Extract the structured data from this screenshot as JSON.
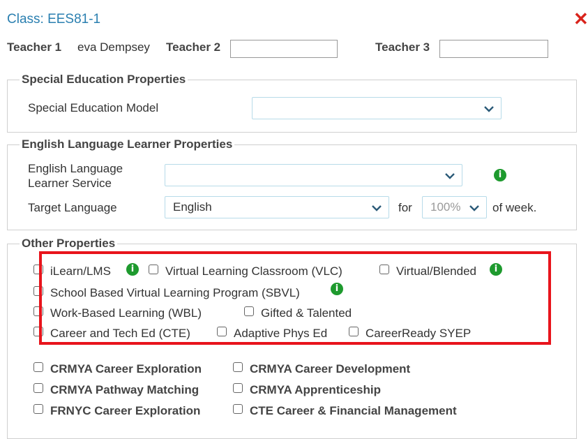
{
  "dialog": {
    "title": "Class: EES81-1",
    "close_symbol": "✕"
  },
  "teachers": {
    "teacher1_label": "Teacher 1",
    "teacher1_value": "eva Dempsey",
    "teacher2_label": "Teacher 2",
    "teacher2_value": "",
    "teacher3_label": "Teacher 3",
    "teacher3_value": ""
  },
  "special_education": {
    "legend": "Special Education Properties",
    "model_label": "Special Education Model",
    "model_value": ""
  },
  "ell": {
    "legend": "English Language Learner Properties",
    "service_label_line1": "English Language",
    "service_label_line2": "Learner Service",
    "service_value": "",
    "target_label": "Target Language",
    "target_value": "English",
    "for_label": "for",
    "percent_value": "100%",
    "week_label": "of week."
  },
  "other": {
    "legend": "Other Properties",
    "checkboxes": [
      "iLearn/LMS",
      "Virtual Learning Classroom (VLC)",
      "Virtual/Blended",
      "School Based Virtual Learning Program (SBVL)",
      "Work-Based Learning (WBL)",
      "Gifted & Talented",
      "Career and Tech Ed (CTE)",
      "Adaptive Phys Ed",
      "CareerReady SYEP",
      "CRMYA Career Exploration",
      "CRMYA Career Development",
      "CRMYA Pathway Matching",
      "CRMYA Apprenticeship",
      "FRNYC Career Exploration",
      "CTE Career & Financial Management"
    ]
  },
  "icons": {
    "info": "i",
    "info_color": "#1e9a2e",
    "close_color": "#d9241c",
    "highlight_color": "#e8141c"
  }
}
